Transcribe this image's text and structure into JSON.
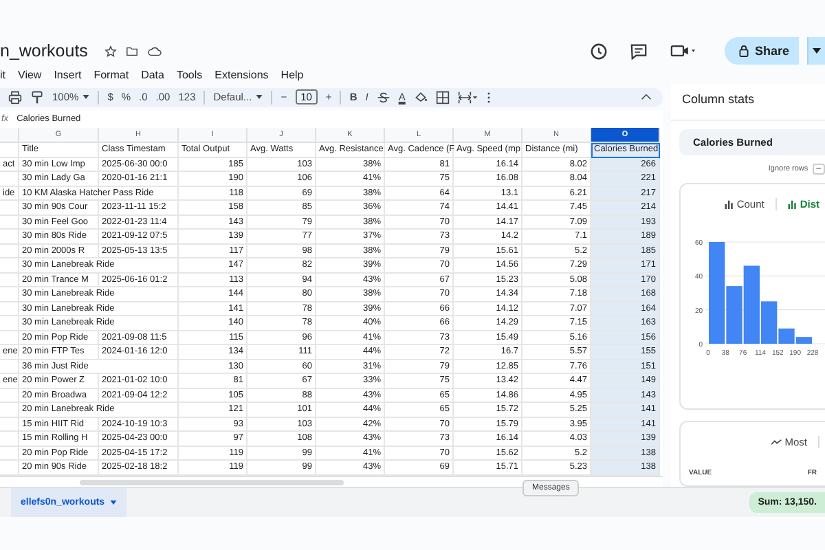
{
  "doc": {
    "title": "n_workouts"
  },
  "menu": [
    "it",
    "View",
    "Insert",
    "Format",
    "Data",
    "Tools",
    "Extensions",
    "Help"
  ],
  "share": {
    "label": "Share"
  },
  "toolbar": {
    "zoom": "100%",
    "currency": "$",
    "percent": "%",
    "dec_less": ".0",
    "dec_more": ".00",
    "number_format": "123",
    "font": "Defaul...",
    "font_size": "10",
    "minus": "−",
    "plus": "+",
    "bold": "B",
    "italic": "I",
    "text_color": "A"
  },
  "formula_bar": {
    "fx": "fx",
    "value": "Calories Burned"
  },
  "sheet": {
    "columns": [
      {
        "label": "G",
        "selected": false
      },
      {
        "label": "H",
        "selected": false
      },
      {
        "label": "I",
        "selected": false
      },
      {
        "label": "J",
        "selected": false
      },
      {
        "label": "K",
        "selected": false
      },
      {
        "label": "L",
        "selected": false
      },
      {
        "label": "M",
        "selected": false
      },
      {
        "label": "N",
        "selected": false
      },
      {
        "label": "O",
        "selected": true
      }
    ],
    "header": {
      "title": "Title",
      "timestamp": "Class Timestam",
      "values": [
        "Total Output",
        "Avg. Watts",
        "Avg. Resistance",
        "Avg. Cadence (F",
        "Avg. Speed (mp",
        "Distance (mi)",
        "Calories Burned"
      ]
    },
    "rows": [
      {
        "col_f": "act",
        "title": "30 min Low Imp",
        "timestamp": "2025-06-30 00:0",
        "values": [
          "185",
          "103",
          "38%",
          "81",
          "16.14",
          "8.02",
          "266"
        ]
      },
      {
        "title": "30 min Lady Ga",
        "timestamp": "2020-01-16 21:1",
        "values": [
          "190",
          "106",
          "41%",
          "75",
          "16.08",
          "8.04",
          "221"
        ]
      },
      {
        "col_f": "ide",
        "title": "10 KM Alaska Hatcher Pass Ride",
        "values": [
          "118",
          "69",
          "38%",
          "64",
          "13.1",
          "6.21",
          "217"
        ]
      },
      {
        "title": "30 min 90s Cour",
        "timestamp": "2023-11-11 15:2",
        "values": [
          "158",
          "85",
          "36%",
          "74",
          "14.41",
          "7.45",
          "214"
        ]
      },
      {
        "title": "30 min Feel Goo",
        "timestamp": "2022-01-23 11:4",
        "values": [
          "143",
          "79",
          "38%",
          "70",
          "14.17",
          "7.09",
          "193"
        ]
      },
      {
        "title": "30 min 80s Ride",
        "timestamp": "2021-09-12 07:5",
        "values": [
          "139",
          "77",
          "37%",
          "73",
          "14.2",
          "7.1",
          "189"
        ]
      },
      {
        "title": "20 min 2000s R",
        "timestamp": "2025-05-13 13:5",
        "values": [
          "117",
          "98",
          "38%",
          "79",
          "15.61",
          "5.2",
          "185"
        ]
      },
      {
        "title": "30 min Lanebreak Ride",
        "values": [
          "147",
          "82",
          "39%",
          "70",
          "14.56",
          "7.29",
          "171"
        ]
      },
      {
        "title": "20 min Trance M",
        "timestamp": "2025-06-16 01:2",
        "values": [
          "113",
          "94",
          "43%",
          "67",
          "15.23",
          "5.08",
          "170"
        ]
      },
      {
        "title": "30 min Lanebreak Ride",
        "values": [
          "144",
          "80",
          "38%",
          "70",
          "14.34",
          "7.18",
          "168"
        ]
      },
      {
        "title": "30 min Lanebreak Ride",
        "values": [
          "141",
          "78",
          "39%",
          "66",
          "14.12",
          "7.07",
          "164"
        ]
      },
      {
        "title": "30 min Lanebreak Ride",
        "values": [
          "140",
          "78",
          "40%",
          "66",
          "14.29",
          "7.15",
          "163"
        ]
      },
      {
        "title": "20 min Pop Ride",
        "timestamp": "2021-09-08 11:5",
        "values": [
          "115",
          "96",
          "41%",
          "73",
          "15.49",
          "5.16",
          "156"
        ]
      },
      {
        "col_f": "ene",
        "title": "20 min FTP Tes",
        "timestamp": "2024-01-16 12:0",
        "values": [
          "134",
          "111",
          "44%",
          "72",
          "16.7",
          "5.57",
          "155"
        ]
      },
      {
        "title": "36 min Just Ride",
        "values": [
          "130",
          "60",
          "31%",
          "79",
          "12.85",
          "7.76",
          "151"
        ]
      },
      {
        "col_f": "ene",
        "title": "20 min Power Z",
        "timestamp": "2021-01-02 10:0",
        "values": [
          "81",
          "67",
          "33%",
          "75",
          "13.42",
          "4.47",
          "149"
        ]
      },
      {
        "title": "20 min Broadwa",
        "timestamp": "2021-09-04 12:2",
        "values": [
          "105",
          "88",
          "43%",
          "65",
          "14.86",
          "4.95",
          "143"
        ]
      },
      {
        "title": "20 min Lanebreak Ride",
        "values": [
          "121",
          "101",
          "44%",
          "65",
          "15.72",
          "5.25",
          "141"
        ]
      },
      {
        "title": "15 min HIIT Rid",
        "timestamp": "2024-10-19 10:3",
        "values": [
          "93",
          "103",
          "42%",
          "70",
          "15.79",
          "3.95",
          "141"
        ]
      },
      {
        "title": "15 min Rolling H",
        "timestamp": "2025-04-23 00:0",
        "values": [
          "97",
          "108",
          "43%",
          "73",
          "16.14",
          "4.03",
          "139"
        ]
      },
      {
        "title": "20 min Pop Ride",
        "timestamp": "2025-04-15 17:2",
        "values": [
          "119",
          "99",
          "41%",
          "70",
          "15.62",
          "5.2",
          "138"
        ]
      },
      {
        "title": "20 min 90s Ride",
        "timestamp": "2025-02-18 18:2",
        "values": [
          "119",
          "99",
          "43%",
          "69",
          "15.71",
          "5.23",
          "138"
        ]
      }
    ]
  },
  "sheet_tab": {
    "label": "ellefs0n_workouts"
  },
  "tooltip": "Messages",
  "sum": "Sum: 13,150.",
  "stats": {
    "title": "Column stats",
    "column": "Calories Burned",
    "ignore_rows": "Ignore rows",
    "ignore_value": "–",
    "tabs": [
      {
        "label": "Count",
        "selected": false
      },
      {
        "label": "Dist",
        "selected": true
      }
    ],
    "chart_data": {
      "type": "bar",
      "x": [
        19,
        57,
        95,
        133,
        171,
        209
      ],
      "values": [
        60,
        34,
        46,
        25,
        9,
        4
      ],
      "xlim": [
        0,
        228
      ],
      "xticks": [
        0,
        38,
        76,
        114,
        152,
        190,
        228
      ],
      "yticks": [
        0,
        20,
        40,
        60
      ],
      "ylim": [
        0,
        60
      ]
    },
    "most": "Most",
    "value_col": "VALUE",
    "freq_col": "FR"
  }
}
